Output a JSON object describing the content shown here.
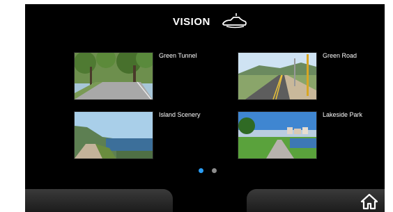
{
  "app": {
    "title": "VISION",
    "logo_icon": "car-icon"
  },
  "gallery": {
    "items": [
      {
        "label": "Green Tunnel",
        "thumb_icon": "tree-lined-road-photo"
      },
      {
        "label": "Green Road",
        "thumb_icon": "highway-photo"
      },
      {
        "label": "Island Scenery",
        "thumb_icon": "coastal-path-photo"
      },
      {
        "label": "Lakeside Park",
        "thumb_icon": "lakeside-path-photo"
      }
    ]
  },
  "pagination": {
    "current": 1,
    "total": 2
  },
  "nav": {
    "home_icon": "home-icon"
  },
  "colors": {
    "background": "#000000",
    "text": "#ffffff",
    "active_dot": "#2a9df4",
    "inactive_dot": "#8c8c8c"
  }
}
